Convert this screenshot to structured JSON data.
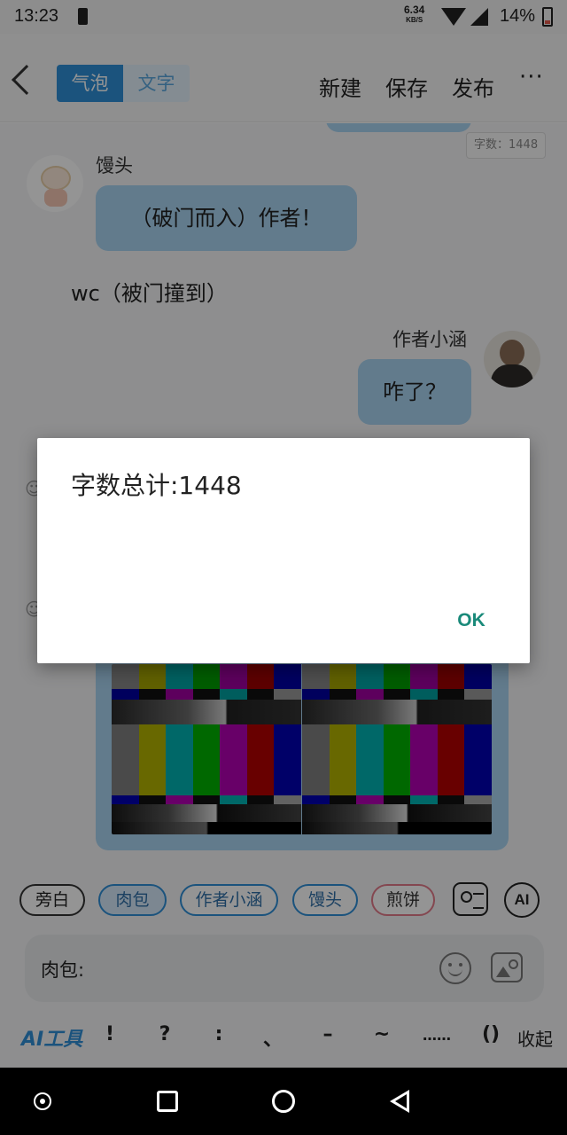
{
  "status_bar": {
    "time": "13:23",
    "net_speed": "6.34",
    "net_unit": "KB/S",
    "battery": "14%"
  },
  "header": {
    "tabs": [
      {
        "label": "气泡",
        "active": true
      },
      {
        "label": "文字",
        "active": false
      }
    ],
    "actions": [
      "新建",
      "保存",
      "发布"
    ],
    "more": "···"
  },
  "word_count_badge": "字数：1448",
  "messages": [
    {
      "type": "left",
      "speaker": "馒头",
      "text": "（破门而入）作者！"
    },
    {
      "type": "narration",
      "text": "wc（被门撞到）"
    },
    {
      "type": "right",
      "speaker": "作者小涵",
      "text": "咋了？"
    }
  ],
  "characters": [
    {
      "label": "旁白",
      "style": "plain"
    },
    {
      "label": "肉包",
      "style": "selected"
    },
    {
      "label": "作者小涵",
      "style": "blue"
    },
    {
      "label": "馒头",
      "style": "blue"
    },
    {
      "label": "煎饼",
      "style": "red"
    }
  ],
  "input": {
    "label": "肉包:"
  },
  "toolbar": {
    "ai_tool": "AI工具",
    "punctuation": [
      "!",
      "?",
      ":",
      "、",
      "–",
      "~",
      "……",
      "()"
    ],
    "collapse": "收起"
  },
  "dialog": {
    "message": "字数总计:1448",
    "ok": "OK"
  },
  "icons": {
    "ai": "AI"
  },
  "colors": {
    "accent": "#2f8fd8",
    "bubble": "#a9d4f2",
    "dialog_ok": "#1a8a7a"
  }
}
